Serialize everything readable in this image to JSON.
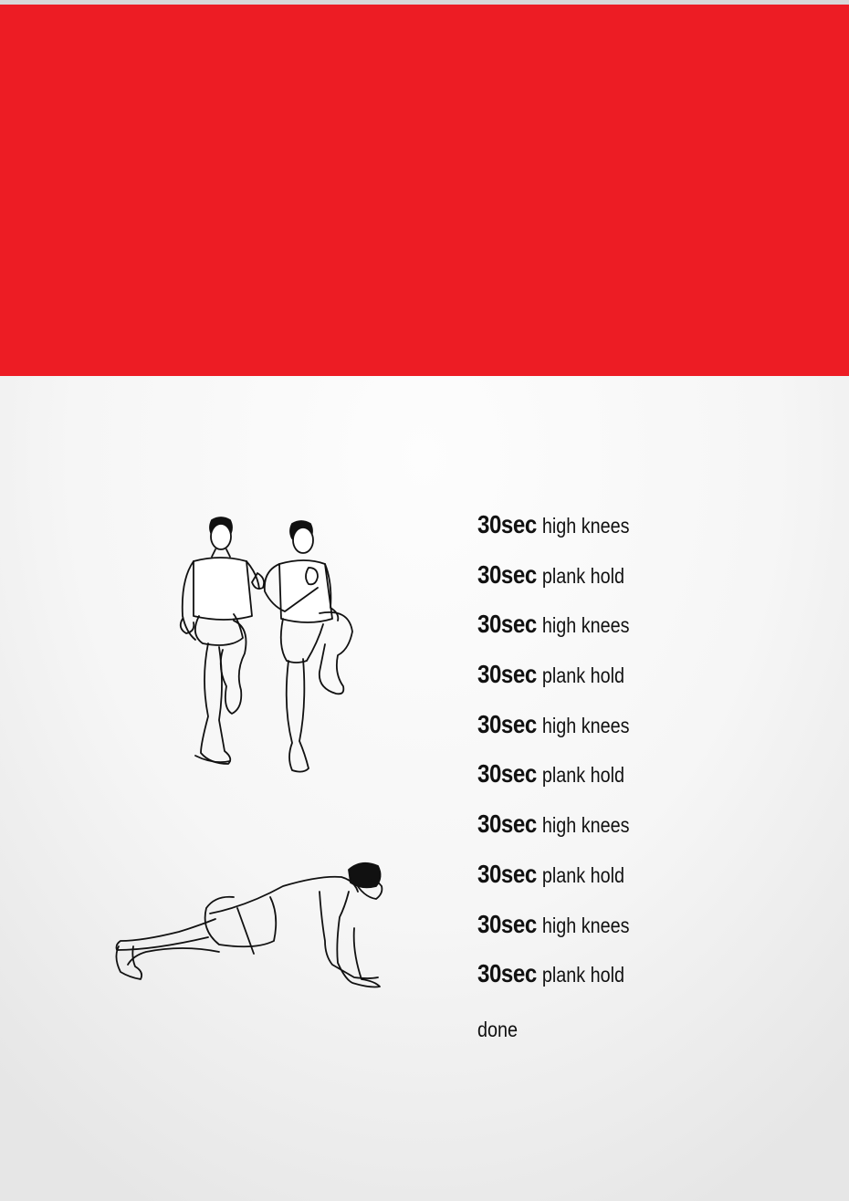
{
  "banner": {
    "color": "#ed1c24"
  },
  "illustrations": [
    {
      "icon": "high-knees-figure-icon",
      "exercise": "high knees"
    },
    {
      "icon": "plank-figure-icon",
      "exercise": "plank hold"
    }
  ],
  "workout": {
    "rows": [
      {
        "duration": "30sec",
        "exercise": "high knees"
      },
      {
        "duration": "30sec",
        "exercise": "plank hold"
      },
      {
        "duration": "30sec",
        "exercise": "high knees"
      },
      {
        "duration": "30sec",
        "exercise": "plank hold"
      },
      {
        "duration": "30sec",
        "exercise": "high knees"
      },
      {
        "duration": "30sec",
        "exercise": "plank hold"
      },
      {
        "duration": "30sec",
        "exercise": "high knees"
      },
      {
        "duration": "30sec",
        "exercise": "plank hold"
      },
      {
        "duration": "30sec",
        "exercise": "high knees"
      },
      {
        "duration": "30sec",
        "exercise": "plank hold"
      }
    ],
    "done_label": "done"
  }
}
